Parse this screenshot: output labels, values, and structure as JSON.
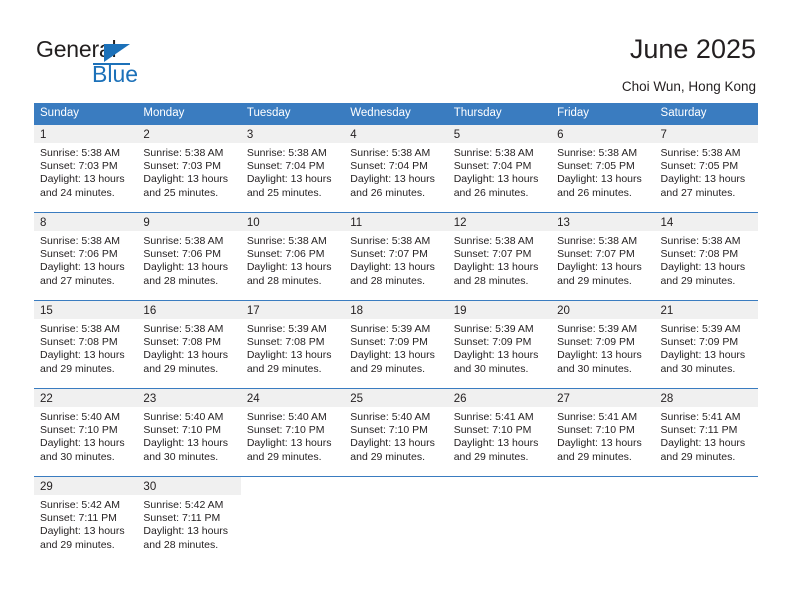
{
  "brand": {
    "name_part1": "General",
    "name_part2": "Blue"
  },
  "header": {
    "title": "June 2025",
    "subtitle": "Choi Wun, Hong Kong"
  },
  "colors": {
    "header_blue": "#3a7cc0",
    "brand_blue": "#1c71b9",
    "daynum_band": "#f0f0f0",
    "text": "#231f20"
  },
  "calendar": {
    "weekday_headers": [
      "Sunday",
      "Monday",
      "Tuesday",
      "Wednesday",
      "Thursday",
      "Friday",
      "Saturday"
    ],
    "weeks": [
      [
        {
          "day": "1",
          "lines": [
            "Sunrise: 5:38 AM",
            "Sunset: 7:03 PM",
            "Daylight: 13 hours",
            "and 24 minutes."
          ]
        },
        {
          "day": "2",
          "lines": [
            "Sunrise: 5:38 AM",
            "Sunset: 7:03 PM",
            "Daylight: 13 hours",
            "and 25 minutes."
          ]
        },
        {
          "day": "3",
          "lines": [
            "Sunrise: 5:38 AM",
            "Sunset: 7:04 PM",
            "Daylight: 13 hours",
            "and 25 minutes."
          ]
        },
        {
          "day": "4",
          "lines": [
            "Sunrise: 5:38 AM",
            "Sunset: 7:04 PM",
            "Daylight: 13 hours",
            "and 26 minutes."
          ]
        },
        {
          "day": "5",
          "lines": [
            "Sunrise: 5:38 AM",
            "Sunset: 7:04 PM",
            "Daylight: 13 hours",
            "and 26 minutes."
          ]
        },
        {
          "day": "6",
          "lines": [
            "Sunrise: 5:38 AM",
            "Sunset: 7:05 PM",
            "Daylight: 13 hours",
            "and 26 minutes."
          ]
        },
        {
          "day": "7",
          "lines": [
            "Sunrise: 5:38 AM",
            "Sunset: 7:05 PM",
            "Daylight: 13 hours",
            "and 27 minutes."
          ]
        }
      ],
      [
        {
          "day": "8",
          "lines": [
            "Sunrise: 5:38 AM",
            "Sunset: 7:06 PM",
            "Daylight: 13 hours",
            "and 27 minutes."
          ]
        },
        {
          "day": "9",
          "lines": [
            "Sunrise: 5:38 AM",
            "Sunset: 7:06 PM",
            "Daylight: 13 hours",
            "and 28 minutes."
          ]
        },
        {
          "day": "10",
          "lines": [
            "Sunrise: 5:38 AM",
            "Sunset: 7:06 PM",
            "Daylight: 13 hours",
            "and 28 minutes."
          ]
        },
        {
          "day": "11",
          "lines": [
            "Sunrise: 5:38 AM",
            "Sunset: 7:07 PM",
            "Daylight: 13 hours",
            "and 28 minutes."
          ]
        },
        {
          "day": "12",
          "lines": [
            "Sunrise: 5:38 AM",
            "Sunset: 7:07 PM",
            "Daylight: 13 hours",
            "and 28 minutes."
          ]
        },
        {
          "day": "13",
          "lines": [
            "Sunrise: 5:38 AM",
            "Sunset: 7:07 PM",
            "Daylight: 13 hours",
            "and 29 minutes."
          ]
        },
        {
          "day": "14",
          "lines": [
            "Sunrise: 5:38 AM",
            "Sunset: 7:08 PM",
            "Daylight: 13 hours",
            "and 29 minutes."
          ]
        }
      ],
      [
        {
          "day": "15",
          "lines": [
            "Sunrise: 5:38 AM",
            "Sunset: 7:08 PM",
            "Daylight: 13 hours",
            "and 29 minutes."
          ]
        },
        {
          "day": "16",
          "lines": [
            "Sunrise: 5:38 AM",
            "Sunset: 7:08 PM",
            "Daylight: 13 hours",
            "and 29 minutes."
          ]
        },
        {
          "day": "17",
          "lines": [
            "Sunrise: 5:39 AM",
            "Sunset: 7:08 PM",
            "Daylight: 13 hours",
            "and 29 minutes."
          ]
        },
        {
          "day": "18",
          "lines": [
            "Sunrise: 5:39 AM",
            "Sunset: 7:09 PM",
            "Daylight: 13 hours",
            "and 29 minutes."
          ]
        },
        {
          "day": "19",
          "lines": [
            "Sunrise: 5:39 AM",
            "Sunset: 7:09 PM",
            "Daylight: 13 hours",
            "and 30 minutes."
          ]
        },
        {
          "day": "20",
          "lines": [
            "Sunrise: 5:39 AM",
            "Sunset: 7:09 PM",
            "Daylight: 13 hours",
            "and 30 minutes."
          ]
        },
        {
          "day": "21",
          "lines": [
            "Sunrise: 5:39 AM",
            "Sunset: 7:09 PM",
            "Daylight: 13 hours",
            "and 30 minutes."
          ]
        }
      ],
      [
        {
          "day": "22",
          "lines": [
            "Sunrise: 5:40 AM",
            "Sunset: 7:10 PM",
            "Daylight: 13 hours",
            "and 30 minutes."
          ]
        },
        {
          "day": "23",
          "lines": [
            "Sunrise: 5:40 AM",
            "Sunset: 7:10 PM",
            "Daylight: 13 hours",
            "and 30 minutes."
          ]
        },
        {
          "day": "24",
          "lines": [
            "Sunrise: 5:40 AM",
            "Sunset: 7:10 PM",
            "Daylight: 13 hours",
            "and 29 minutes."
          ]
        },
        {
          "day": "25",
          "lines": [
            "Sunrise: 5:40 AM",
            "Sunset: 7:10 PM",
            "Daylight: 13 hours",
            "and 29 minutes."
          ]
        },
        {
          "day": "26",
          "lines": [
            "Sunrise: 5:41 AM",
            "Sunset: 7:10 PM",
            "Daylight: 13 hours",
            "and 29 minutes."
          ]
        },
        {
          "day": "27",
          "lines": [
            "Sunrise: 5:41 AM",
            "Sunset: 7:10 PM",
            "Daylight: 13 hours",
            "and 29 minutes."
          ]
        },
        {
          "day": "28",
          "lines": [
            "Sunrise: 5:41 AM",
            "Sunset: 7:11 PM",
            "Daylight: 13 hours",
            "and 29 minutes."
          ]
        }
      ],
      [
        {
          "day": "29",
          "lines": [
            "Sunrise: 5:42 AM",
            "Sunset: 7:11 PM",
            "Daylight: 13 hours",
            "and 29 minutes."
          ]
        },
        {
          "day": "30",
          "lines": [
            "Sunrise: 5:42 AM",
            "Sunset: 7:11 PM",
            "Daylight: 13 hours",
            "and 28 minutes."
          ]
        },
        {
          "day": "",
          "lines": []
        },
        {
          "day": "",
          "lines": []
        },
        {
          "day": "",
          "lines": []
        },
        {
          "day": "",
          "lines": []
        },
        {
          "day": "",
          "lines": []
        }
      ]
    ]
  }
}
